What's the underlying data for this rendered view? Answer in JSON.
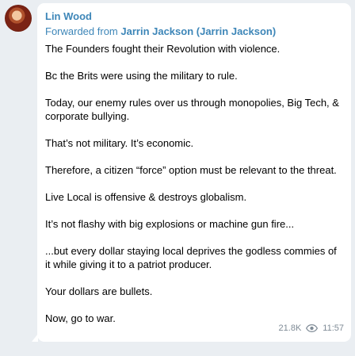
{
  "post": {
    "author": "Lin Wood",
    "forwarded_prefix": "Forwarded from",
    "forwarded_from": "Jarrin Jackson (Jarrin Jackson)",
    "paragraphs": [
      "The Founders fought their Revolution with violence.",
      "Bc the Brits were using the military to rule.",
      "Today, our enemy rules over us through monopolies, Big Tech, & corporate bullying.",
      "That’s not military. It’s economic.",
      "Therefore, a citizen “force” option must be relevant to the threat.",
      "Live Local is offensive & destroys globalism.",
      "It’s not flashy with big explosions or machine gun fire...",
      "...but every dollar staying local deprives the godless commies of it while giving it to a patriot producer.",
      "Your dollars are bullets.",
      "Now, go to war."
    ],
    "views": "21.8K",
    "views_icon": "eye-icon",
    "time": "11:57"
  },
  "colors": {
    "background": "#eaeef2",
    "bubble": "#ffffff",
    "accent": "#3d86b8",
    "meta": "#7f8b96"
  }
}
